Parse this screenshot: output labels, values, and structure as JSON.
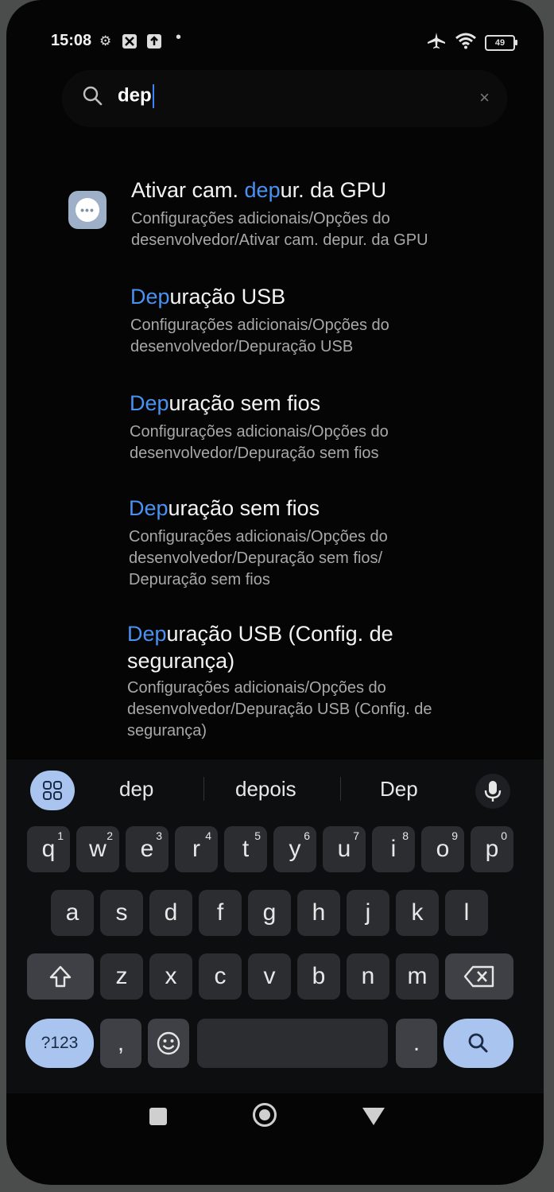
{
  "status_bar": {
    "time": "15:08",
    "battery": "49"
  },
  "search": {
    "query": "dep",
    "clear": "×"
  },
  "results": [
    {
      "title_before": "Ativar cam. ",
      "title_match": "dep",
      "title_after": "ur. da GPU",
      "path_line1": "Configurações adicionais/Opções do",
      "path_line2": "desenvolvedor/Ativar cam. depur. da GPU"
    },
    {
      "title_before": "",
      "title_match": "Dep",
      "title_after": "uração USB",
      "path_line1": "Configurações adicionais/Opções do",
      "path_line2": "desenvolvedor/Depuração USB"
    },
    {
      "title_before": "",
      "title_match": "Dep",
      "title_after": "uração sem fios",
      "path_line1": "Configurações adicionais/Opções do",
      "path_line2": "desenvolvedor/Depuração sem fios"
    },
    {
      "title_before": "",
      "title_match": "Dep",
      "title_after": "uração sem fios",
      "path_line1": "Configurações adicionais/Opções do",
      "path_line2": "desenvolvedor/Depuração sem fios/",
      "path_line3": "Depuração sem fios"
    },
    {
      "title_before": "",
      "title_match": "Dep",
      "title_after": "uração USB (Config. de",
      "title_line2": "segurança)",
      "path_line1": "Configurações adicionais/Opções do",
      "path_line2": "desenvolvedor/Depuração USB (Config. de",
      "path_line3": "segurança)"
    }
  ],
  "keyboard": {
    "suggestions": [
      "dep",
      "depois",
      "Dep"
    ],
    "row1": [
      "q",
      "w",
      "e",
      "r",
      "t",
      "y",
      "u",
      "i",
      "o",
      "p"
    ],
    "row1_nums": [
      "1",
      "2",
      "3",
      "4",
      "5",
      "6",
      "7",
      "8",
      "9",
      "0"
    ],
    "row2": [
      "a",
      "s",
      "d",
      "f",
      "g",
      "h",
      "j",
      "k",
      "l"
    ],
    "row3": [
      "z",
      "x",
      "c",
      "v",
      "b",
      "n",
      "m"
    ],
    "symbols_key": "?123",
    "comma_key": ",",
    "period_key": "."
  }
}
